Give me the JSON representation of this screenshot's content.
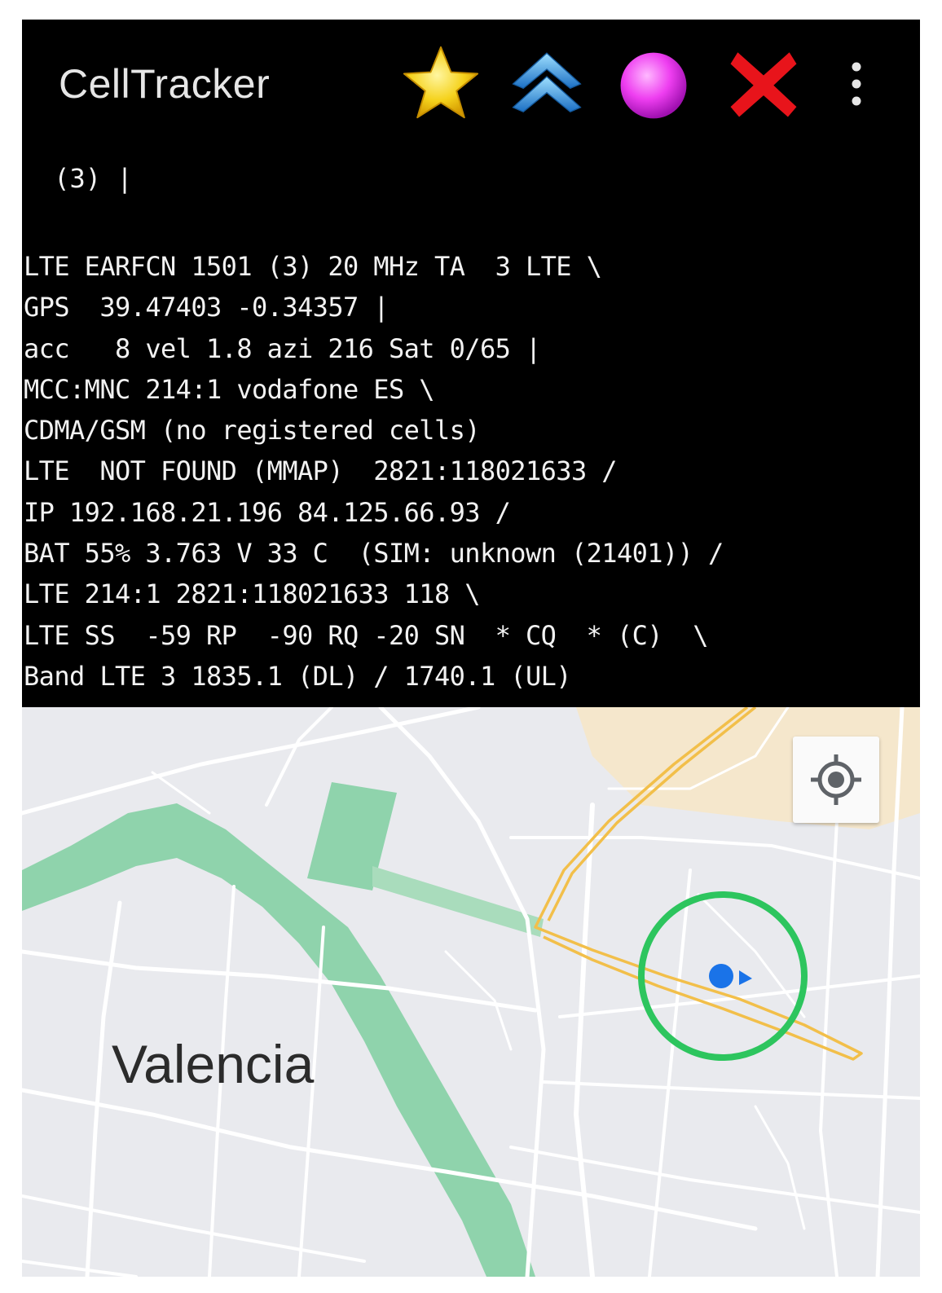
{
  "app_bar": {
    "title": "CellTracker",
    "actions": [
      {
        "icon": "star-icon",
        "color": "#f5d21c"
      },
      {
        "icon": "chevron-up-double-icon",
        "color": "#3aa7e8"
      },
      {
        "icon": "purple-dot-icon",
        "color": "#ee3ef0"
      },
      {
        "icon": "close-icon",
        "color": "#e8141b"
      },
      {
        "icon": "overflow-menu-icon",
        "color": "#e6e6e6"
      }
    ]
  },
  "info": {
    "header": " (3) |",
    "lines": [
      "LTE EARFCN 1501 (3) 20 MHz TA  3 LTE \\",
      "GPS  39.47403 -0.34357 |",
      "acc   8 vel 1.8 azi 216 Sat 0/65 |",
      "MCC:MNC 214:1 vodafone ES \\",
      "CDMA/GSM (no registered cells)",
      "LTE  NOT FOUND (MMAP)  2821:118021633 /",
      "IP 192.168.21.196 84.125.66.93 /",
      "BAT 55% 3.763 V 33 C  (SIM: unknown (21401)) /",
      "LTE 214:1 2821:118021633 118 \\",
      "LTE SS  -59 RP  -90 RQ -20 SN  * CQ  * (C)  \\",
      "Band LTE 3 1835.1 (DL) / 1740.1 (UL)"
    ]
  },
  "map": {
    "city_label": "Valencia",
    "colors": {
      "background": "#e9eaee",
      "park": "#8fd3ac",
      "road": "#ffffff",
      "rail": "#f2bf4a",
      "district": "#f5e7cc",
      "accuracy_circle": "#2dc55e",
      "position_dot": "#1a73e8"
    },
    "locate_button_icon": "my-location-icon"
  }
}
